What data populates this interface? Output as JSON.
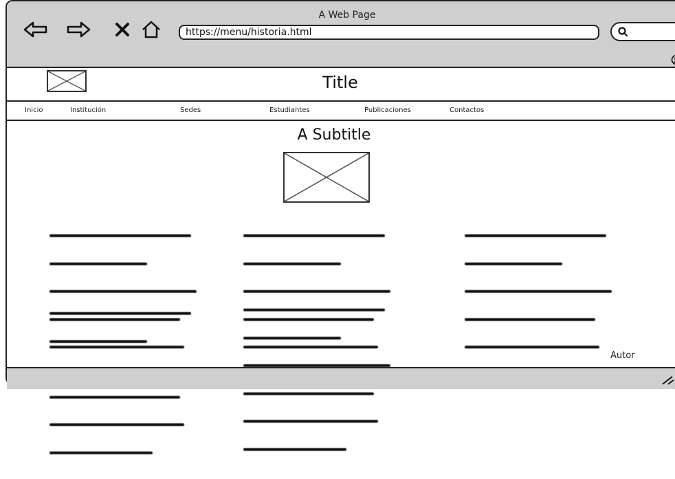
{
  "window": {
    "title": "A Web Page"
  },
  "toolbar": {
    "url": "https://menu/historia.html",
    "back_icon": "arrow-left-icon",
    "forward_icon": "arrow-right-icon",
    "close_icon": "close-icon",
    "home_icon": "home-icon",
    "search_icon": "search-icon"
  },
  "header": {
    "title": "Title"
  },
  "menu": {
    "items": [
      {
        "label": "Inicio"
      },
      {
        "label": "Institución"
      },
      {
        "label": "Sedes"
      },
      {
        "label": "Estudiantes"
      },
      {
        "label": "Publicaciones"
      },
      {
        "label": "Contactos"
      }
    ]
  },
  "main": {
    "subtitle": "A Subtitle",
    "author": "Autor"
  },
  "colors": {
    "chrome": "#cfcfcf",
    "border": "#222222",
    "background": "#ffffff"
  }
}
